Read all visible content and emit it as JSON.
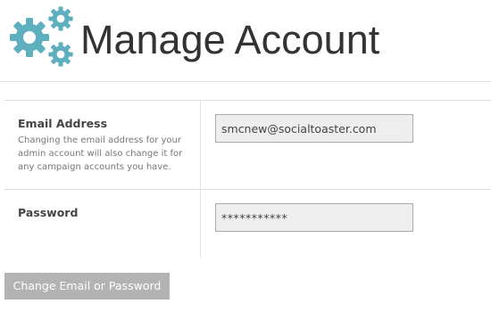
{
  "header": {
    "title": "Manage Account",
    "logo_icon": "gears-icon",
    "logo_color": "#5fb0bf"
  },
  "form": {
    "email": {
      "label": "Email Address",
      "help": "Changing the email address for your admin account will also change it for any campaign accounts you have.",
      "value": "smcnew@socialtoaster.com"
    },
    "password": {
      "label": "Password",
      "value": "***********"
    },
    "submit_label": "Change Email or Password"
  }
}
